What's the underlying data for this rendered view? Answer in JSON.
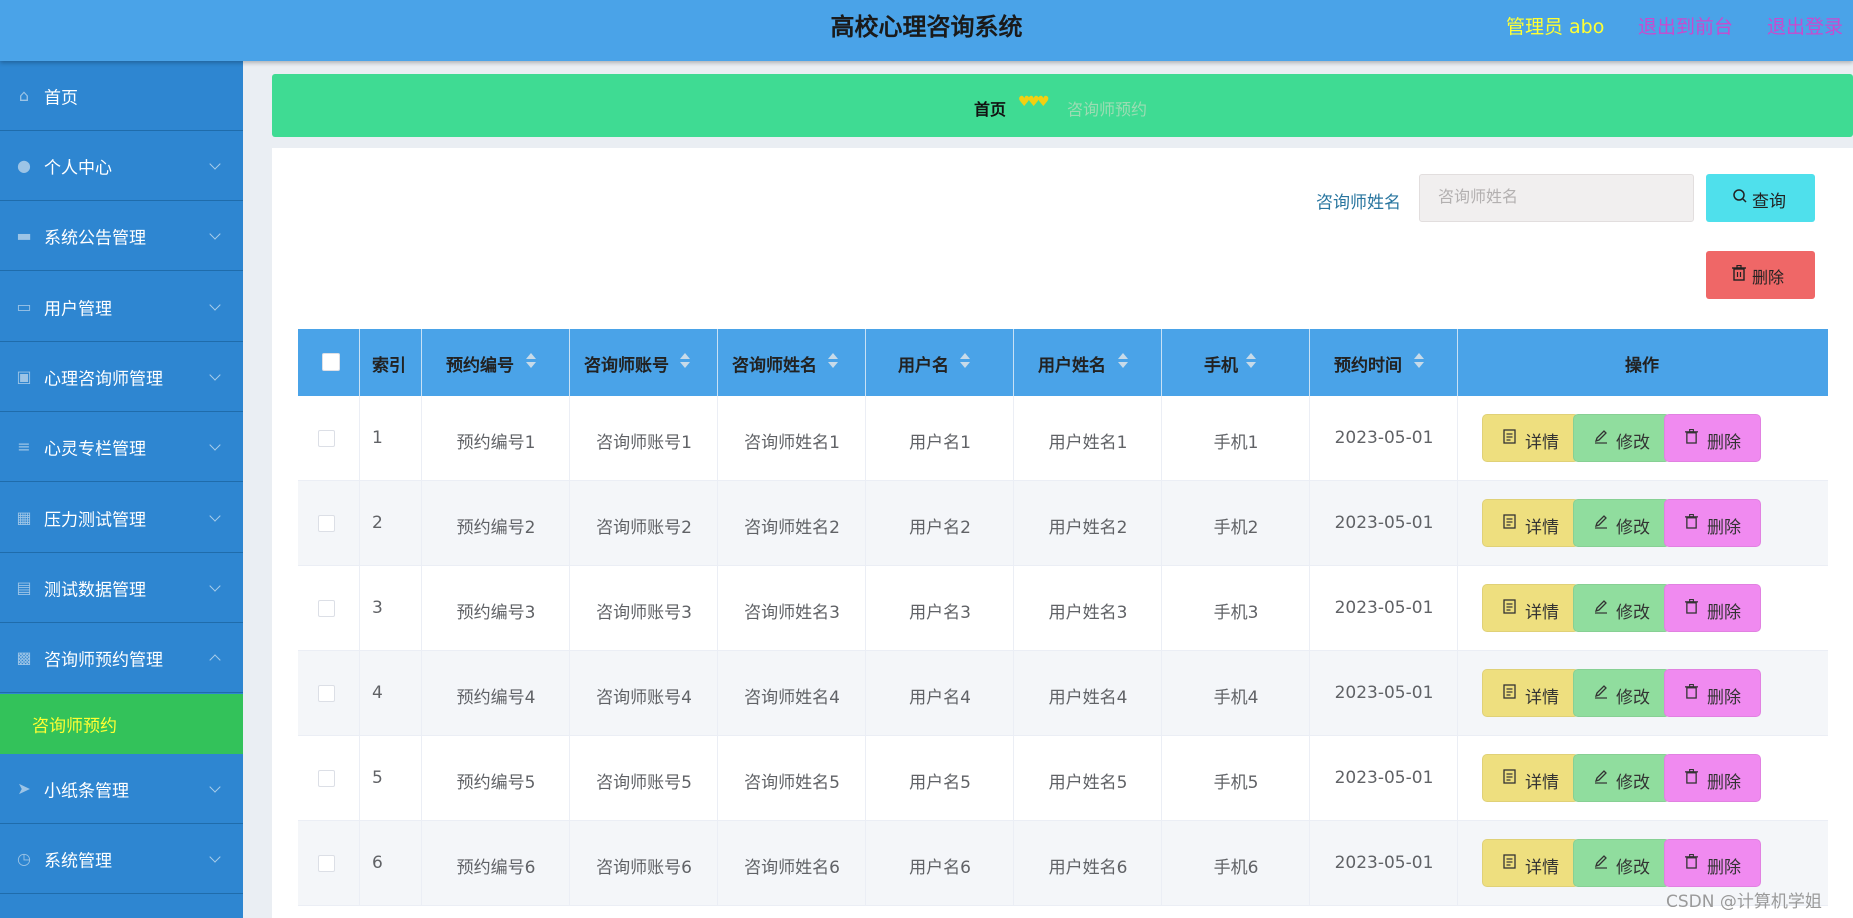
{
  "header": {
    "title": "高校心理咨询系统",
    "admin": "管理员 abo",
    "back_to_front": "退出到前台",
    "logout": "退出登录"
  },
  "sidebar": {
    "items": [
      {
        "label": "首页",
        "icon": "home-icon"
      },
      {
        "label": "个人中心",
        "icon": "user-icon"
      },
      {
        "label": "系统公告管理",
        "icon": "monitor-icon"
      },
      {
        "label": "用户管理",
        "icon": "chat-icon"
      },
      {
        "label": "心理咨询师管理",
        "icon": "clipboard-icon"
      },
      {
        "label": "心灵专栏管理",
        "icon": "list-icon"
      },
      {
        "label": "压力测试管理",
        "icon": "grid-icon"
      },
      {
        "label": "测试数据管理",
        "icon": "screen-icon"
      },
      {
        "label": "咨询师预约管理",
        "icon": "message-icon"
      },
      {
        "label": "小纸条管理",
        "icon": "paper-plane-icon"
      },
      {
        "label": "系统管理",
        "icon": "clock-icon"
      }
    ],
    "active_sub": "咨询师预约"
  },
  "breadcrumb": {
    "home": "首页",
    "separator": "♥♥♥",
    "current": "咨询师预约"
  },
  "search": {
    "label": "咨询师姓名",
    "placeholder": "咨询师姓名",
    "query_label": "查询",
    "delete_label": "删除"
  },
  "table": {
    "columns": [
      "索引",
      "预约编号",
      "咨询师账号",
      "咨询师姓名",
      "用户名",
      "用户姓名",
      "手机",
      "预约时间",
      "操作"
    ],
    "rows": [
      {
        "index": "1",
        "code": "预约编号1",
        "account": "咨询师账号1",
        "name": "咨询师姓名1",
        "user": "用户名1",
        "user_name": "用户姓名1",
        "phone": "手机1",
        "time": "2023-05-01"
      },
      {
        "index": "2",
        "code": "预约编号2",
        "account": "咨询师账号2",
        "name": "咨询师姓名2",
        "user": "用户名2",
        "user_name": "用户姓名2",
        "phone": "手机2",
        "time": "2023-05-01"
      },
      {
        "index": "3",
        "code": "预约编号3",
        "account": "咨询师账号3",
        "name": "咨询师姓名3",
        "user": "用户名3",
        "user_name": "用户姓名3",
        "phone": "手机3",
        "time": "2023-05-01"
      },
      {
        "index": "4",
        "code": "预约编号4",
        "account": "咨询师账号4",
        "name": "咨询师姓名4",
        "user": "用户名4",
        "user_name": "用户姓名4",
        "phone": "手机4",
        "time": "2023-05-01"
      },
      {
        "index": "5",
        "code": "预约编号5",
        "account": "咨询师账号5",
        "name": "咨询师姓名5",
        "user": "用户名5",
        "user_name": "用户姓名5",
        "phone": "手机5",
        "time": "2023-05-01"
      },
      {
        "index": "6",
        "code": "预约编号6",
        "account": "咨询师账号6",
        "name": "咨询师姓名6",
        "user": "用户名6",
        "user_name": "用户姓名6",
        "phone": "手机6",
        "time": "2023-05-01"
      }
    ],
    "actions": {
      "detail": "详情",
      "edit": "修改",
      "delete": "删除"
    }
  },
  "watermark": "CSDN @计算机学姐",
  "colors": {
    "header_bg": "#4aa3e8",
    "sidebar_bg": "#2e86d1",
    "active_sub_bg": "#33c25a",
    "breadcrumb_bg": "#3fdb93",
    "query_btn": "#4fe0ec",
    "delete_btn": "#ef6767",
    "detail_btn": "#eedf7f",
    "edit_btn": "#90dd9e",
    "row_delete_btn": "#f08af0"
  }
}
